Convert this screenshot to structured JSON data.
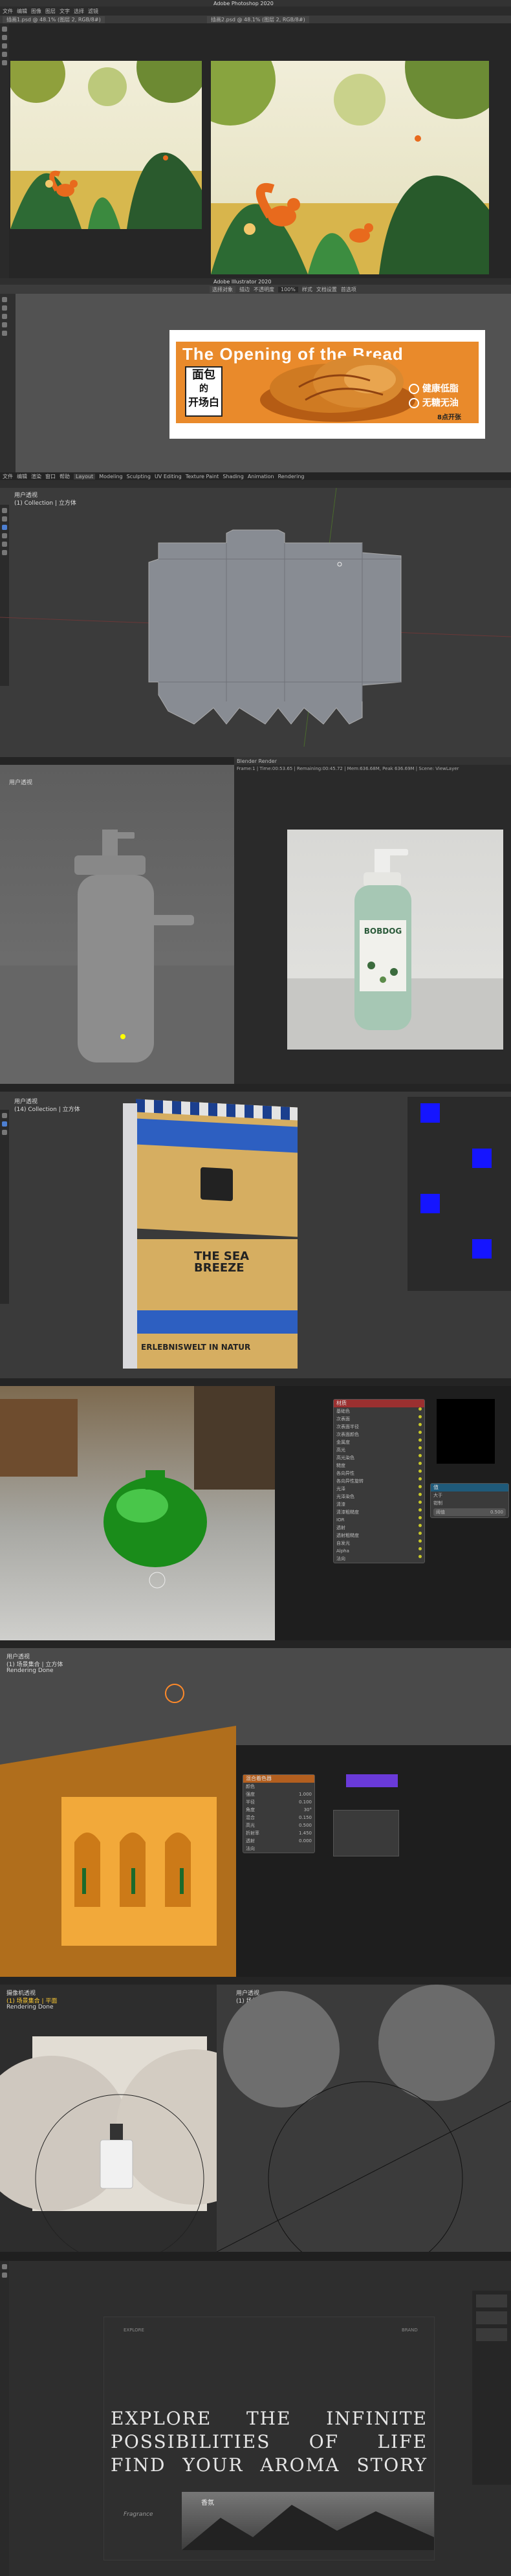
{
  "ps": {
    "app_title": "Adobe Photoshop 2020",
    "menu": [
      "文件",
      "编辑",
      "图像",
      "图层",
      "文字",
      "选择",
      "滤镜",
      "3D",
      "视图",
      "窗口",
      "帮助"
    ],
    "tab_left": "插画1.psd @ 48.1% (图层 2, RGB/8#)",
    "tab_right": "插画2.psd @ 48.1% (图层 2, RGB/8#)"
  },
  "ai": {
    "app_title": "Adobe Illustrator 2020",
    "controls": [
      "选择对象",
      "描边",
      "不透明度",
      "100%",
      "样式",
      "文档设置",
      "首选项"
    ],
    "banner": {
      "headline": "The Opening of the Bread",
      "cn_title": [
        "面包",
        "的",
        "开场白"
      ],
      "badges": [
        "健康低脂",
        "无糖无油"
      ],
      "footer": "8点开张"
    }
  },
  "blender_box": {
    "menu": [
      "文件",
      "编辑",
      "渲染",
      "窗口",
      "帮助",
      "Layout",
      "Modeling",
      "Sculpting",
      "UV Editing",
      "Texture Paint",
      "Shading",
      "Animation",
      "Rendering"
    ],
    "view_title": "用户透视",
    "view_sub": "(1) Collection | 立方体"
  },
  "blender_bottle": {
    "view_title": "用户透视",
    "render_title": "Blender Render",
    "render_info": "Frame:1 | Time:00:53.65 | Remaining:00:45.72 | Mem:636.68M, Peak 636.69M | Scene: ViewLayer",
    "label_brand": "BOBDOG"
  },
  "blender_pack": {
    "view_title": "用户透视",
    "view_sub": "(14) Collection | 立方体",
    "box_text_1": "THE SEA BREEZE",
    "box_text_2": "ERLEBNISWELT IN NATUR"
  },
  "blender_glass": {
    "node_title": "材质",
    "node_rows": [
      "基础色",
      "次表面",
      "次表面半径",
      "次表面颜色",
      "金属度",
      "高光",
      "高光染色",
      "糙度",
      "各向异性",
      "各向异性旋转",
      "光泽",
      "光泽染色",
      "清漆",
      "清漆粗糙度",
      "IOR",
      "透射",
      "透射粗糙度",
      "自发光",
      "Alpha",
      "法向"
    ],
    "value_node_title": "值",
    "value_rows": [
      "大于",
      "钳制",
      "阈值"
    ],
    "value_val": "0.500"
  },
  "blender_arch": {
    "view_title": "用户透视",
    "view_sub": "(1) 场景集合 | 立方体",
    "sub2": "Rendering Done",
    "props": [
      "颜色",
      "强度",
      "半径",
      "角度",
      "混合",
      "高光",
      "折射率",
      "透射",
      "法向"
    ],
    "prop_vals": [
      "",
      "1.000",
      "0.100",
      "30°",
      "0.150",
      "0.500",
      "1.450",
      "0.000",
      ""
    ],
    "node_title": "混合着色器"
  },
  "blender_spheres": {
    "view_title": "摄像机透视",
    "view_sub": "(1) 场景集合 | 平面",
    "sub2": "Rendering Done",
    "right_title": "用户透视",
    "right_sub": "(1) 场景集合 | 平面"
  },
  "final": {
    "tag_left": "EXPLORE",
    "tag_right": "BRAND",
    "line1": [
      "EXPLORE",
      "THE",
      "INFINITE"
    ],
    "line2": [
      "POSSIBILITIES",
      "OF",
      "LIFE"
    ],
    "line3": [
      "FIND",
      "YOUR",
      "AROMA",
      "STORY"
    ],
    "footer_left": "Fragrance",
    "footer_brand": "香氛"
  }
}
